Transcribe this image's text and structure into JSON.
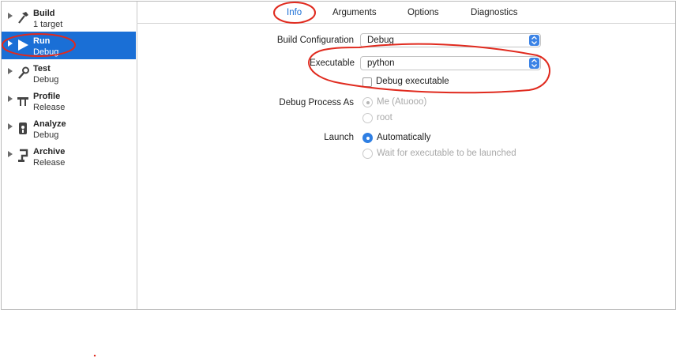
{
  "sidebar": {
    "items": [
      {
        "title": "Build",
        "subtitle": "1 target",
        "icon": "hammer-icon"
      },
      {
        "title": "Run",
        "subtitle": "Debug",
        "icon": "play-icon",
        "selected": true
      },
      {
        "title": "Test",
        "subtitle": "Debug",
        "icon": "wrench-icon"
      },
      {
        "title": "Profile",
        "subtitle": "Release",
        "icon": "instruments-icon"
      },
      {
        "title": "Analyze",
        "subtitle": "Debug",
        "icon": "analyze-icon"
      },
      {
        "title": "Archive",
        "subtitle": "Release",
        "icon": "archive-icon"
      }
    ]
  },
  "tabs": [
    "Info",
    "Arguments",
    "Options",
    "Diagnostics"
  ],
  "active_tab": "Info",
  "form": {
    "build_config_label": "Build Configuration",
    "build_config_value": "Debug",
    "executable_label": "Executable",
    "executable_value": "python",
    "debug_executable_label": "Debug executable",
    "debug_process_label": "Debug Process As",
    "debug_process_options": [
      "Me (Atuooo)",
      "root"
    ],
    "launch_label": "Launch",
    "launch_options": [
      "Automatically",
      "Wait for executable to be launched"
    ]
  },
  "colors": {
    "accent": "#1a6fd6",
    "annotation": "#e02a1e"
  }
}
